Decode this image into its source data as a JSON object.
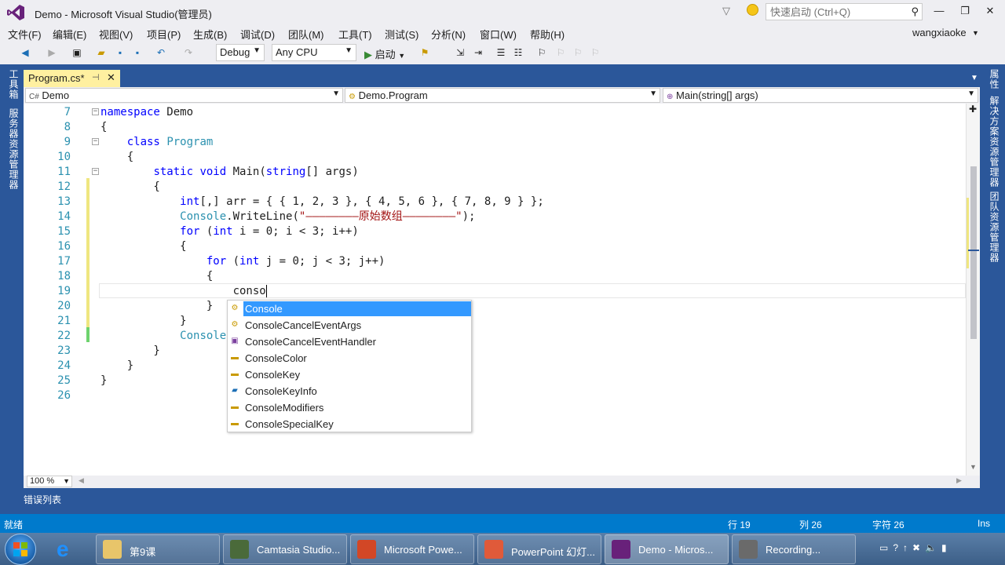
{
  "window": {
    "title": "Demo - Microsoft Visual Studio(管理员)",
    "quick_launch_placeholder": "快速启动 (Ctrl+Q)",
    "user": "wangxiaoke"
  },
  "menu": [
    "文件(F)",
    "编辑(E)",
    "视图(V)",
    "项目(P)",
    "生成(B)",
    "调试(D)",
    "团队(M)",
    "工具(T)",
    "测试(S)",
    "分析(N)",
    "窗口(W)",
    "帮助(H)"
  ],
  "toolbar": {
    "config": "Debug",
    "platform": "Any CPU",
    "start_label": "启动"
  },
  "left_rail": [
    "工具箱",
    "服务器资源管理器"
  ],
  "right_rail": [
    "属性",
    "解决方案资源管理器",
    "团队资源管理器"
  ],
  "tab": {
    "label": "Program.cs*"
  },
  "navbar": {
    "project": "Demo",
    "type": "Demo.Program",
    "member": "Main(string[] args)"
  },
  "code": [
    {
      "n": "7",
      "text": "namespace Demo"
    },
    {
      "n": "8",
      "text": "{"
    },
    {
      "n": "9",
      "text": "    class Program"
    },
    {
      "n": "10",
      "text": "    {"
    },
    {
      "n": "11",
      "text": "        static void Main(string[] args)"
    },
    {
      "n": "12",
      "text": "        {"
    },
    {
      "n": "13",
      "text": "            int[,] arr = { { 1, 2, 3 }, { 4, 5, 6 }, { 7, 8, 9 } };"
    },
    {
      "n": "14",
      "text": "            Console.WriteLine(\"————————原始数组————————\");"
    },
    {
      "n": "15",
      "text": "            for (int i = 0; i < 3; i++)"
    },
    {
      "n": "16",
      "text": "            {"
    },
    {
      "n": "17",
      "text": "                for (int j = 0; j < 3; j++)"
    },
    {
      "n": "18",
      "text": "                {"
    },
    {
      "n": "19",
      "text": "                    conso"
    },
    {
      "n": "20",
      "text": "                }"
    },
    {
      "n": "21",
      "text": "            }"
    },
    {
      "n": "22",
      "text": "            Console."
    },
    {
      "n": "23",
      "text": "        }"
    },
    {
      "n": "24",
      "text": "    }"
    },
    {
      "n": "25",
      "text": "}"
    },
    {
      "n": "26",
      "text": ""
    }
  ],
  "completion": {
    "items": [
      {
        "label": "Console",
        "icon": "class-icon",
        "selected": true
      },
      {
        "label": "ConsoleCancelEventArgs",
        "icon": "class-icon"
      },
      {
        "label": "ConsoleCancelEventHandler",
        "icon": "delegate-icon"
      },
      {
        "label": "ConsoleColor",
        "icon": "enum-icon"
      },
      {
        "label": "ConsoleKey",
        "icon": "enum-icon"
      },
      {
        "label": "ConsoleKeyInfo",
        "icon": "struct-icon"
      },
      {
        "label": "ConsoleModifiers",
        "icon": "enum-icon"
      },
      {
        "label": "ConsoleSpecialKey",
        "icon": "enum-icon"
      }
    ]
  },
  "editor": {
    "zoom": "100 %"
  },
  "bottom_tab": "错误列表",
  "status": {
    "state": "就绪",
    "line": "行 19",
    "col": "列 26",
    "char": "字符 26",
    "mode": "Ins"
  },
  "taskbar": [
    {
      "label": "第9课"
    },
    {
      "label": "Camtasia Studio..."
    },
    {
      "label": "Microsoft Powe..."
    },
    {
      "label": "PowerPoint 幻灯..."
    },
    {
      "label": "Demo - Micros..."
    },
    {
      "label": "Recording..."
    }
  ],
  "colors": {
    "frame": "#2b579a",
    "status": "#007acc",
    "tab_active": "#fff0a0",
    "keyword": "#0000ff",
    "type": "#2b91af",
    "string": "#a31515",
    "selection": "#3399ff"
  }
}
